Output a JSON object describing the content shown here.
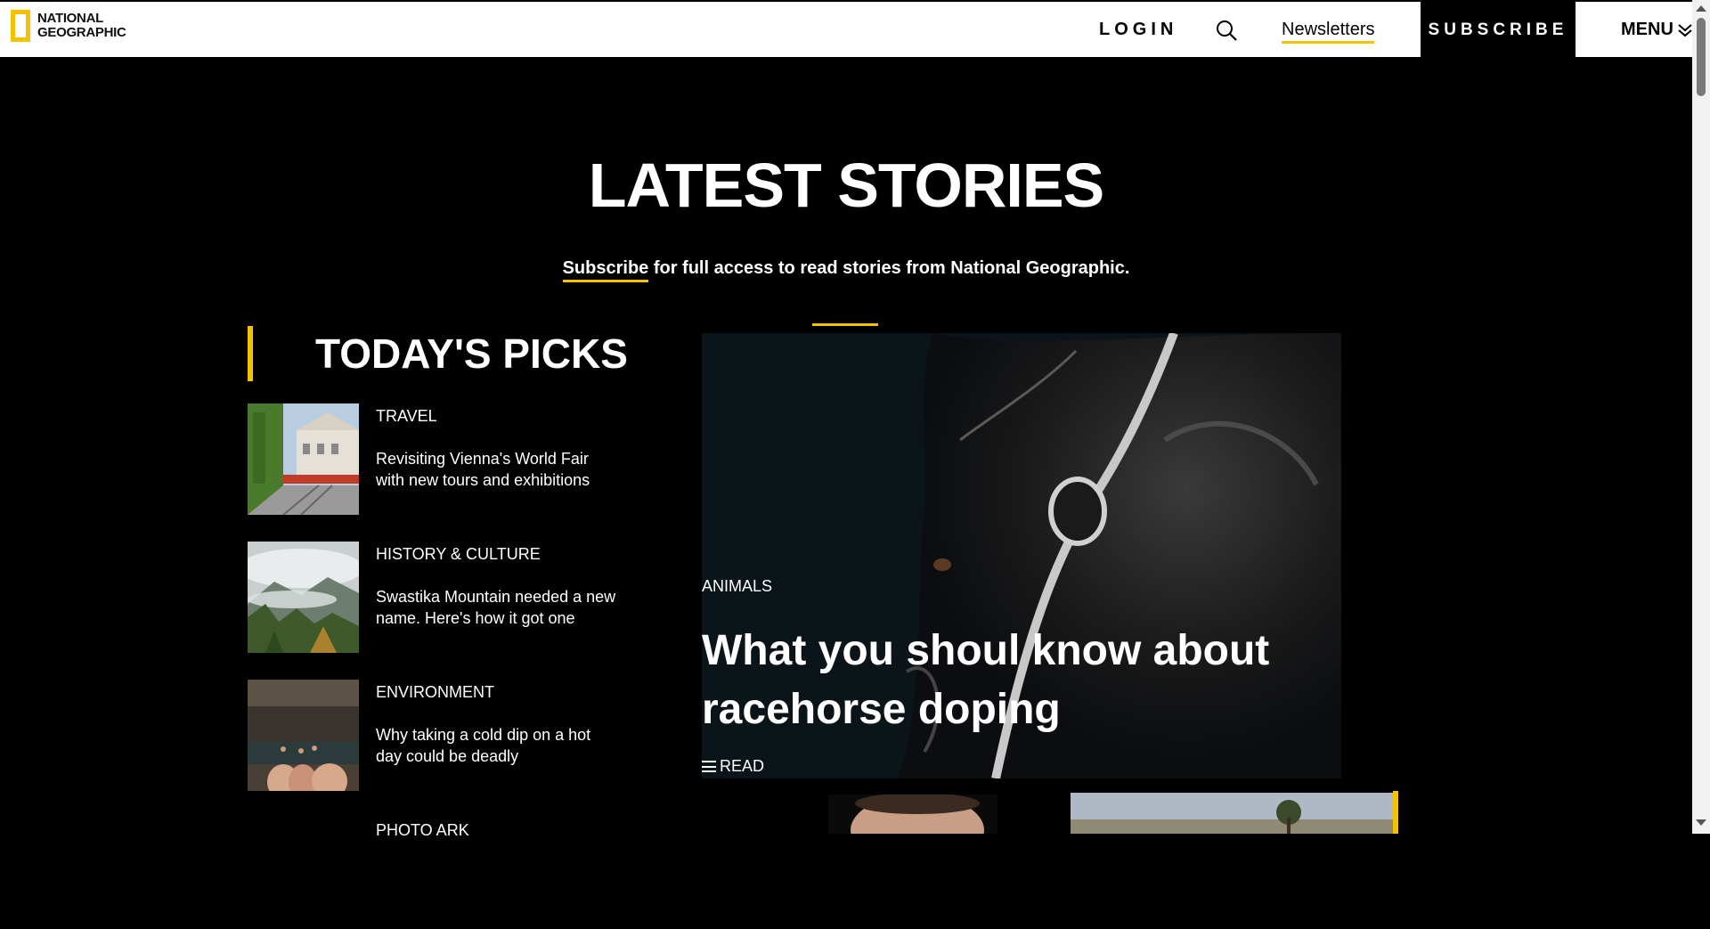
{
  "header": {
    "logo_text": "NATIONAL GEOGRAPHIC",
    "login_label": "LOGIN",
    "newsletters_label": "Newsletters",
    "subscribe_label": "SUBSCRIBE",
    "menu_label": "MENU"
  },
  "hero": {
    "title": "LATEST STORIES",
    "subscribe_link": "Subscribe",
    "subline_rest": " for full access to read stories from National Geographic."
  },
  "picks": {
    "heading": "TODAY'S PICKS",
    "items": [
      {
        "category": "TRAVEL",
        "title": "Revisiting Vienna's World Fair with new tours and exhibitions"
      },
      {
        "category": "HISTORY & CULTURE",
        "title": "Swastika Mountain needed a new name. Here's how it got one"
      },
      {
        "category": "ENVIRONMENT",
        "title": "Why taking a cold dip on a hot day could be deadly"
      },
      {
        "category": "PHOTO ARK",
        "title": ""
      }
    ]
  },
  "feature": {
    "category": "ANIMALS",
    "title": "What you shoul know about racehorse doping",
    "read_label": "READ"
  },
  "colors": {
    "accent": "#f5c200",
    "background": "#000000",
    "header_bg": "#ffffff"
  }
}
